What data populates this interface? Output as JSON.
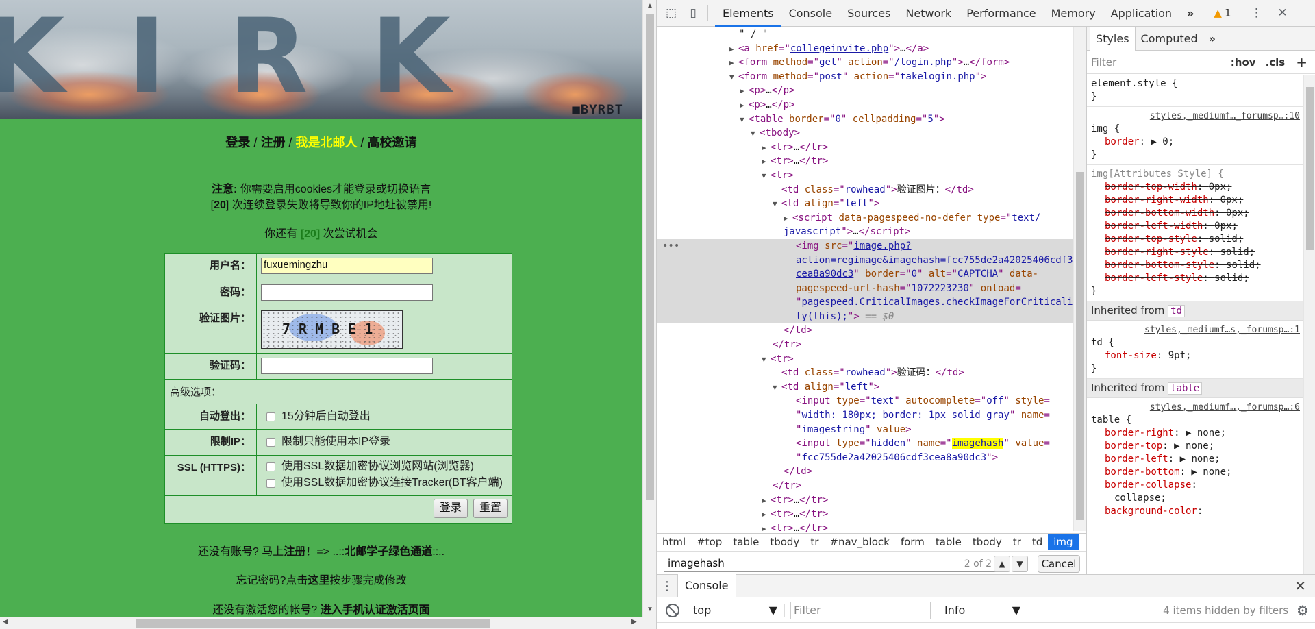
{
  "page": {
    "banner": {
      "letters": "KIRK",
      "mark": "■BYRBT"
    },
    "nav": {
      "login": "登录",
      "register": "注册",
      "bupt": "我是北邮人",
      "college": "高校邀请",
      "sep": "/"
    },
    "notice": {
      "label": "注意:",
      "text": "你需要启用cookies才能登录或切换语言"
    },
    "ban_warning": {
      "prefix": "[",
      "num": "20",
      "suffix": "] 次连续登录失败将导致你的IP地址被禁用!"
    },
    "attempts": {
      "prefix": "你还有",
      "num": "[20]",
      "suffix": "次尝试机会"
    },
    "form": {
      "username_label": "用户名：",
      "username_value": "fuxuemingzhu",
      "password_label": "密码：",
      "captcha_label": "验证图片：",
      "captcha_text": "7RMBE1",
      "code_label": "验证码：",
      "advanced_label": "高级选项：",
      "autologout_label": "自动登出：",
      "autologout_option": "15分钟后自动登出",
      "restrict_ip_label": "限制IP：",
      "restrict_ip_option": "限制只能使用本IP登录",
      "ssl_label": "SSL (HTTPS)：",
      "ssl_browse_option": "使用SSL数据加密协议浏览网站(浏览器)",
      "ssl_tracker_option": "使用SSL数据加密协议连接Tracker(BT客户端)",
      "login_button": "登录",
      "reset_button": "重置"
    },
    "no_account": {
      "prefix": "还没有账号? 马上",
      "link": "注册",
      "middle": "！=> ..::",
      "green": "北邮学子绿色通道",
      "suffix": "::.."
    },
    "forgot": {
      "prefix": "忘记密码?点击",
      "link": "这里",
      "suffix": "按步骤完成修改"
    },
    "activate": {
      "prefix": "还没有激活您的帐号? ",
      "link": "进入手机认证激活页面"
    }
  },
  "devtools": {
    "tabs": [
      "Elements",
      "Console",
      "Sources",
      "Network",
      "Performance",
      "Memory",
      "Application"
    ],
    "active_tab": "Elements",
    "more_tabs": "»",
    "warning_count": "1",
    "dom": {
      "l1": "\" / \"",
      "l2_href": "collegeinvite.php",
      "l3_method": "get",
      "l3_action": "/login.php",
      "l4_method": "post",
      "l4_action": "takelogin.php",
      "l7_border": "0",
      "l7_cellpadding": "5",
      "l12_class": "rowhead",
      "l12_text": "验证图片：",
      "l13_align": "left",
      "l14_type": "text/",
      "l15_type": "javascript",
      "img_src_1": "image.php?",
      "img_src_2": "action=regimage&imagehash=fcc755de2a42025406cdf3",
      "img_src_3": "cea8a90dc3",
      "img_border": "0",
      "img_alt": "CAPTCHA",
      "img_hash": "1072223230",
      "img_onload_1": "pagespeed.CriticalImages.checkImageForCriticali",
      "img_onload_2": "ty(this);",
      "dollar": "== $0",
      "l24_text": "验证码：",
      "input_type": "text",
      "input_autocomplete": "off",
      "input_style_1": "width: 180px; border: 1px solid gray",
      "input_name": "imagestring",
      "hidden_type": "hidden",
      "hidden_name": "imagehash",
      "hidden_value": "fcc755de2a42025406cdf3cea8a90dc3"
    },
    "breadcrumbs": [
      "html",
      "#top",
      "table",
      "tbody",
      "tr",
      "#nav_block",
      "form",
      "table",
      "tbody",
      "tr",
      "td",
      "img"
    ],
    "search": {
      "value": "imagehash",
      "count": "2 of 2",
      "cancel": "Cancel"
    },
    "styles": {
      "tabs": [
        "Styles",
        "Computed"
      ],
      "filter_placeholder": "Filter",
      "hov": ":hov",
      "cls": ".cls",
      "rule1": "element.style {",
      "rule2_src": "styles,_mediumf…_forumsp…:10",
      "rule2_sel": "img {",
      "rule2_prop": "border",
      "rule2_val": "0;",
      "rule3_sel": "img[Attributes Style] {",
      "rule3_props": [
        [
          "border-top-width",
          "0px;"
        ],
        [
          "border-right-width",
          "0px;"
        ],
        [
          "border-bottom-width",
          "0px;"
        ],
        [
          "border-left-width",
          "0px;"
        ],
        [
          "border-top-style",
          "solid;"
        ],
        [
          "border-right-style",
          "solid;"
        ],
        [
          "border-bottom-style",
          "solid;"
        ],
        [
          "border-left-style",
          "solid;"
        ]
      ],
      "inh1_label": "Inherited from",
      "inh1_tag": "td",
      "rule4_src": "styles,_mediumf…s,_forumsp…:1",
      "rule4_sel": "td {",
      "rule4_prop": "font-size",
      "rule4_val": "9pt;",
      "inh2_label": "Inherited from",
      "inh2_tag": "table",
      "rule5_src": "styles,_mediumf…,_forumsp…:6",
      "rule5_sel": "table {",
      "rule5_props": [
        [
          "border-right",
          "none;"
        ],
        [
          "border-top",
          "none;"
        ],
        [
          "border-left",
          "none;"
        ],
        [
          "border-bottom",
          "none;"
        ],
        [
          "border-collapse",
          "collapse;"
        ],
        [
          "background-color",
          ""
        ]
      ]
    },
    "drawer": {
      "tab": "Console",
      "context": "top",
      "filter_placeholder": "Filter",
      "level": "Info",
      "hidden_items": "4 items hidden by filters"
    }
  }
}
